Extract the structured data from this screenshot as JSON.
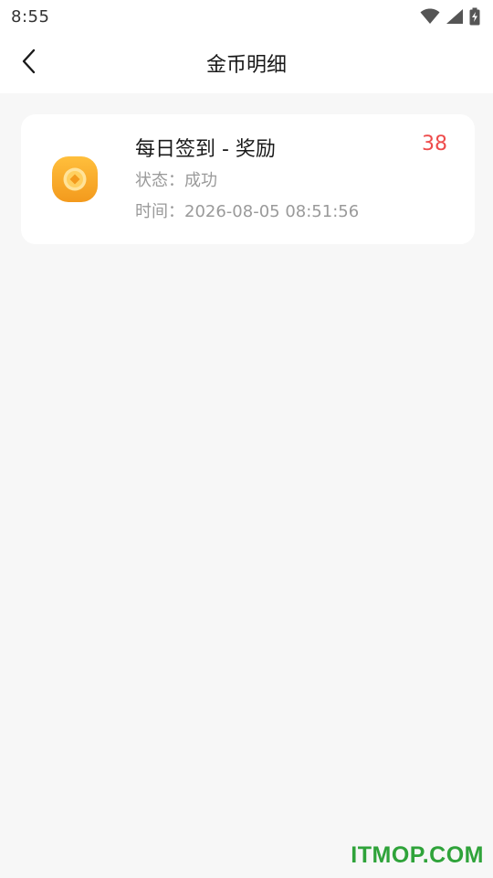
{
  "status_bar": {
    "time": "8:55",
    "icons": [
      "wifi-icon",
      "cellular-signal-icon",
      "battery-charging-icon"
    ]
  },
  "header": {
    "back_icon": "chevron-left-icon",
    "title": "金币明细"
  },
  "records": [
    {
      "icon": "gold-coin-icon",
      "title": "每日签到 - 奖励",
      "amount": "38",
      "status_label": "状态：",
      "status_value": "成功",
      "time_label": "时间：",
      "time_value": "2026-08-05 08:51:56"
    }
  ],
  "watermark": "ITMOP.COM",
  "colors": {
    "background": "#f7f7f7",
    "card": "#ffffff",
    "amount": "#ee4b4b",
    "secondary_text": "#9a9a9a",
    "coin": "#f5a623",
    "watermark": "#2fa33a"
  }
}
